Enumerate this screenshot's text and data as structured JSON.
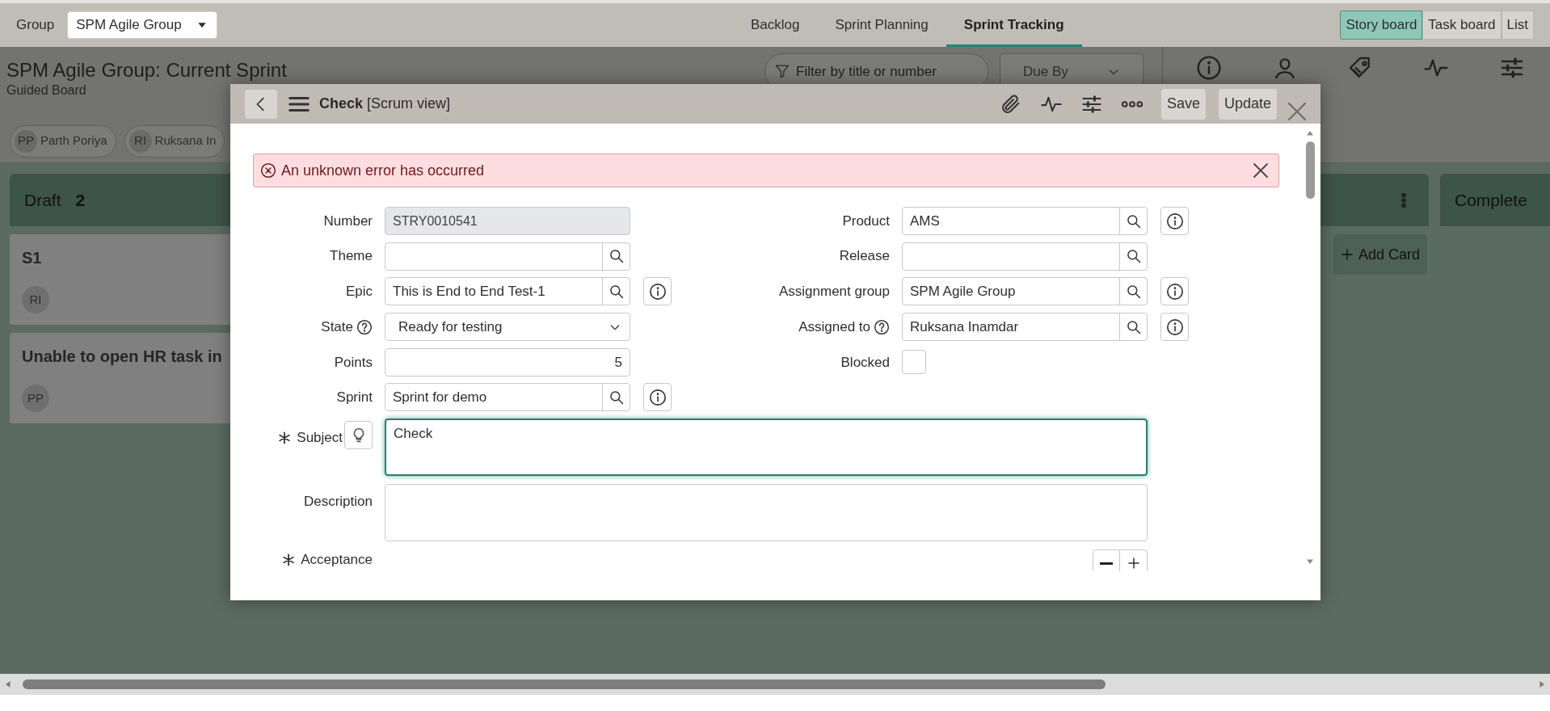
{
  "top_bar": {
    "group_label": "Group",
    "group_select": "SPM Agile Group",
    "tabs": [
      {
        "label": "Backlog",
        "selected": false
      },
      {
        "label": "Sprint Planning",
        "selected": false
      },
      {
        "label": "Sprint Tracking",
        "selected": true
      }
    ],
    "views": [
      {
        "label": "Story board",
        "selected": true
      },
      {
        "label": "Task board",
        "selected": false
      },
      {
        "label": "List",
        "selected": false
      }
    ]
  },
  "header": {
    "title": "SPM Agile Group: Current Sprint",
    "subtitle": "Guided Board",
    "filter": {
      "placeholder": "Filter by title or number"
    },
    "sort_select": "Due By"
  },
  "assignees": [
    {
      "initials": "PP",
      "name": "Parth Poriya"
    },
    {
      "initials": "RI",
      "name": "Ruksana In"
    }
  ],
  "board": {
    "columns": [
      {
        "kind": "lane",
        "title": "Draft",
        "count": "2",
        "cards": [
          {
            "title": "S1",
            "avatar": "RI"
          },
          {
            "title": "Unable to open HR task in",
            "avatar": "PP"
          }
        ]
      },
      {
        "kind": "menu_lane",
        "action": "Add Card"
      },
      {
        "kind": "lane",
        "title": "Complete"
      }
    ]
  },
  "modal": {
    "title": "Check",
    "view": "[Scrum view]",
    "actions": [
      "Save",
      "Update"
    ],
    "error": "An unknown error has occurred",
    "left_fields": [
      {
        "kind": "readonly",
        "label": "Number",
        "value": "STRY0010541",
        "info": false,
        "help": false
      },
      {
        "kind": "reference",
        "label": "Theme",
        "info": false,
        "help": false
      },
      {
        "kind": "reference",
        "label": "Epic",
        "value": "This is End to End Test-1",
        "info": true,
        "help": false
      },
      {
        "kind": "select",
        "label": "State",
        "value": "Ready for testing",
        "info": false,
        "help": true
      },
      {
        "kind": "number",
        "label": "Points",
        "value": "5",
        "info": false,
        "help": false
      },
      {
        "kind": "reference",
        "label": "Sprint",
        "value": "Sprint for demo",
        "info": true,
        "help": false
      }
    ],
    "right_fields": [
      {
        "kind": "reference",
        "label": "Product",
        "value": "AMS",
        "info": true,
        "help": false
      },
      {
        "kind": "reference",
        "label": "Release",
        "info": false,
        "help": false
      },
      {
        "kind": "reference",
        "label": "Assignment group",
        "value": "SPM Agile Group",
        "info": true,
        "help": false
      },
      {
        "kind": "reference",
        "label": "Assigned to",
        "value": "Ruksana Inamdar",
        "info": true,
        "help": true
      },
      {
        "kind": "checkbox",
        "label": "Blocked",
        "checked": false,
        "info": false,
        "help": false
      }
    ],
    "text_areas": [
      {
        "label": "Subject",
        "value": "Check",
        "required": true,
        "focused": true,
        "suggestions": true
      },
      {
        "label": "Description",
        "required": false,
        "focused": false,
        "suggestions": false
      }
    ],
    "acceptance": {
      "label": "Acceptance",
      "required": true
    }
  }
}
